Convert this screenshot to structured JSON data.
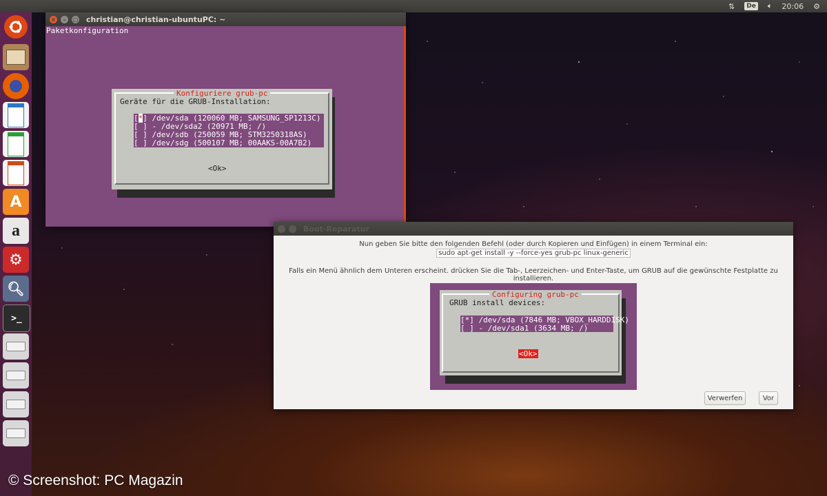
{
  "top_panel": {
    "keyboard_layout": "De",
    "clock": "20:06",
    "icons": [
      "network-arrows-icon",
      "volume-icon",
      "power-gear-icon"
    ]
  },
  "launcher": {
    "items": [
      {
        "name": "ubuntu-dash",
        "color": "#dd4814"
      },
      {
        "name": "files",
        "color": "#a47c4d"
      },
      {
        "name": "firefox",
        "color": "#e66000"
      },
      {
        "name": "libreoffice-writer",
        "color": "#2a78c4"
      },
      {
        "name": "libreoffice-calc",
        "color": "#2e9d3a"
      },
      {
        "name": "libreoffice-impress",
        "color": "#d14a1a"
      },
      {
        "name": "software-center",
        "color": "#f08a24"
      },
      {
        "name": "amazon",
        "color": "#e8e8e8"
      },
      {
        "name": "system-settings",
        "color": "#cc2a2a"
      },
      {
        "name": "disk-search",
        "color": "#5c6c8c"
      },
      {
        "name": "terminal",
        "color": "#2c2c2c"
      },
      {
        "name": "usb-drive",
        "color": "#d8d8d8"
      },
      {
        "name": "drive-1",
        "color": "#d8d8d8"
      },
      {
        "name": "drive-2",
        "color": "#d8d8d8"
      },
      {
        "name": "drive-3",
        "color": "#d8d8d8"
      }
    ]
  },
  "terminal": {
    "title": "christian@christian-ubuntuPC: ~",
    "header": "Paketkonfiguration",
    "dialog": {
      "title": "Konfiguriere grub-pc",
      "prompt": "Geräte für die GRUB-Installation:",
      "rows": [
        {
          "check": "*",
          "label": "/dev/sda (120060 MB; SAMSUNG_SP1213C)"
        },
        {
          "check": " ",
          "label": "- /dev/sda2 (20971 MB; /)"
        },
        {
          "check": " ",
          "label": "/dev/sdb (250059 MB; STM3250318AS)"
        },
        {
          "check": " ",
          "label": "/dev/sdg (500107 MB; 00AAKS-00A7B2)"
        }
      ],
      "ok": "<Ok>"
    }
  },
  "boot_repair": {
    "title": "Boot-Reparatur",
    "line1": "Nun geben Sie bitte den folgenden Befehl (oder durch Kopieren und Einfügen) in einem Terminal ein:",
    "command": "sudo apt-get install -y --force-yes grub-pc linux-generic",
    "line2": "Falls ein Menü ähnlich dem Unteren erscheint. drücken Sie die Tab-, Leerzeichen- und Enter-Taste, um GRUB auf die gewünschte Festplatte zu installieren.",
    "example": {
      "title": "Configuring grub-pc",
      "prompt": "GRUB install devices:",
      "rows": [
        {
          "text": "[*] /dev/sda (7846 MB; VBOX_HARDDISK)"
        },
        {
          "text": "[ ] - /dev/sda1 (3634 MB; /)"
        }
      ],
      "ok": "<Ok>"
    },
    "buttons": {
      "cancel": "Verwerfen",
      "next": "Vor"
    }
  },
  "watermark": "© Screenshot: PC Magazin",
  "colors": {
    "ubuntu_orange": "#dd4814",
    "terminal_purple": "#7f4a7c",
    "dialog_grey": "#c6c6c0",
    "alert_red": "#e2211a"
  }
}
